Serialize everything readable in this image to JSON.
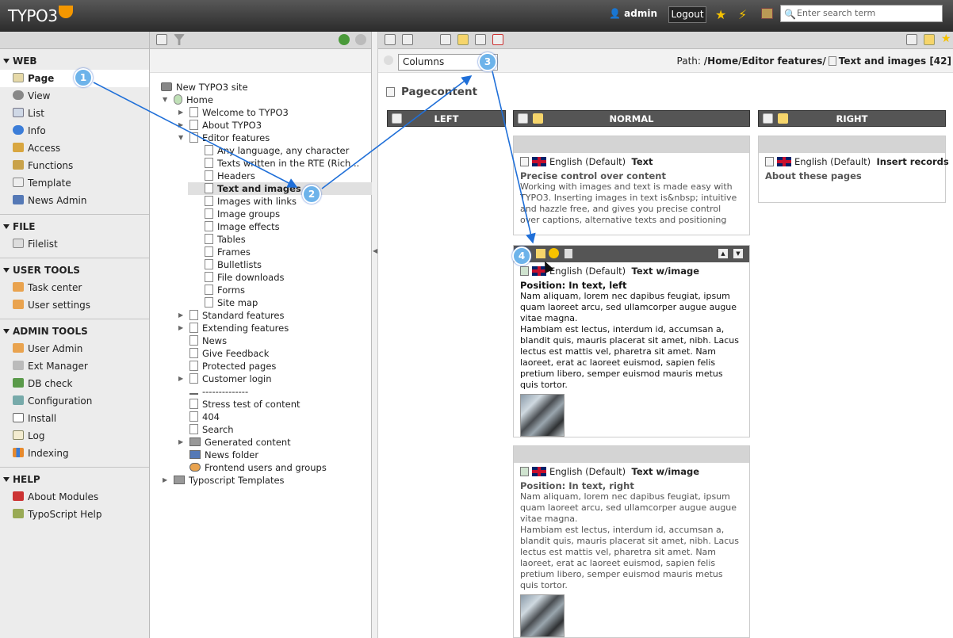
{
  "topbar": {
    "logo": "TYPO3",
    "user": "admin",
    "logout": "Logout",
    "search_placeholder": "Enter search term"
  },
  "modules": {
    "groups": [
      {
        "title": "WEB",
        "items": [
          "Page",
          "View",
          "List",
          "Info",
          "Access",
          "Functions",
          "Template",
          "News Admin"
        ]
      },
      {
        "title": "FILE",
        "items": [
          "Filelist"
        ]
      },
      {
        "title": "USER TOOLS",
        "items": [
          "Task center",
          "User settings"
        ]
      },
      {
        "title": "ADMIN TOOLS",
        "items": [
          "User Admin",
          "Ext Manager",
          "DB check",
          "Configuration",
          "Install",
          "Log",
          "Indexing"
        ]
      },
      {
        "title": "HELP",
        "items": [
          "About Modules",
          "TypoScript Help"
        ]
      }
    ]
  },
  "tree": {
    "root": "New TYPO3 site",
    "nodes": {
      "n0": "Home",
      "n1": "Welcome to TYPO3",
      "n2": "About TYPO3",
      "n3": "Editor features",
      "n4": "Any language, any character",
      "n5": "Texts written in the RTE (Rich...",
      "n6": "Headers",
      "n7": "Text and images",
      "n8": "Images with links",
      "n9": "Image groups",
      "n10": "Image effects",
      "n11": "Tables",
      "n12": "Frames",
      "n13": "Bulletlists",
      "n14": "File downloads",
      "n15": "Forms",
      "n16": "Site map",
      "n17": "Standard features",
      "n18": "Extending features",
      "n19": "News",
      "n20": "Give Feedback",
      "n21": "Protected pages",
      "n22": "Customer login",
      "n23": "--------------",
      "n24": "Stress test of content",
      "n25": "404",
      "n26": "Search",
      "n27": "Generated content",
      "n28": "News folder",
      "n29": "Frontend users and groups",
      "n30": "Typoscript Templates"
    }
  },
  "content": {
    "column_select": "Columns",
    "path_label": "Path:",
    "path_value": "/Home/Editor features/",
    "path_page": "Text and images [42]",
    "section_title": "Pagecontent",
    "columns": {
      "left": "LEFT",
      "normal": "NORMAL",
      "right": "RIGHT"
    },
    "elements": {
      "e1": {
        "lang": "English (Default)",
        "type": "Text",
        "header": "Precise control over content",
        "body": "Working with images and text is made easy with TYPO3. Inserting images in text is&nbsp; intuitive and hazzle free, and gives you precise control over captions, alternative texts and positioning"
      },
      "e2": {
        "lang": "English (Default)",
        "type": "Text w/image",
        "header": "Position: In text, left",
        "body1": "Nam aliquam, lorem nec dapibus feugiat, ipsum quam laoreet arcu, sed ullamcorper augue augue vitae magna.",
        "body2": "Hambiam est lectus, interdum id, accumsan a, blandit quis, mauris placerat sit amet, nibh. Lacus lectus est mattis vel, pharetra sit amet. Nam laoreet, erat ac laoreet euismod, sapien felis pretium libero, semper euismod mauris metus quis tortor."
      },
      "e3": {
        "lang": "English (Default)",
        "type": "Text w/image",
        "header": "Position: In text, right",
        "body1": "Nam aliquam, lorem nec dapibus feugiat, ipsum quam laoreet arcu, sed ullamcorper augue augue vitae magna.",
        "body2": "Hambiam est lectus, interdum id, accumsan a, blandit quis, mauris placerat sit amet, nibh. Lacus lectus est mattis vel, pharetra sit amet. Nam laoreet, erat ac laoreet euismod, sapien felis pretium libero, semper euismod mauris metus quis tortor."
      },
      "e4": {
        "lang": "English (Default)",
        "type": "Insert records",
        "header": "About these pages"
      }
    }
  },
  "badges": [
    "1",
    "2",
    "3",
    "4"
  ],
  "colors": {
    "arrow": "#1f6fd8",
    "badge": "#6db3ea",
    "accent": "#f49700"
  }
}
